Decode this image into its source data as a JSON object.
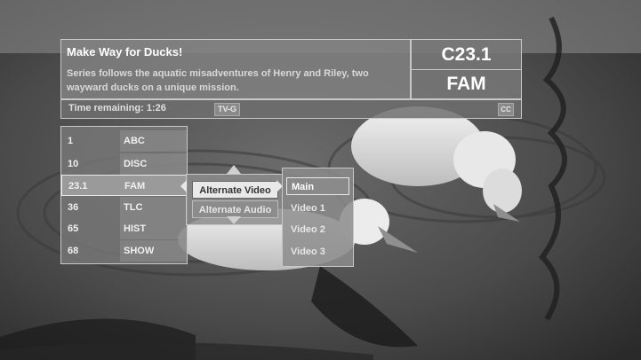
{
  "program": {
    "title": "Make Way for Ducks!",
    "description": "Series follows the aquatic misadventures of Henry and Riley, two wayward ducks on a unique mission.",
    "time_remaining": "Time remaining: 1:26",
    "rating": "TV-G",
    "cc": "CC"
  },
  "current_channel": {
    "number": "C23.1",
    "callsign": "FAM"
  },
  "channel_list": [
    {
      "number": "1",
      "callsign": "ABC",
      "selected": false
    },
    {
      "number": "10",
      "callsign": "DISC",
      "selected": false
    },
    {
      "number": "23.1",
      "callsign": "FAM",
      "selected": true
    },
    {
      "number": "36",
      "callsign": "TLC",
      "selected": false
    },
    {
      "number": "65",
      "callsign": "HIST",
      "selected": false
    },
    {
      "number": "68",
      "callsign": "SHOW",
      "selected": false
    }
  ],
  "options": {
    "alternate_video": "Alternate Video",
    "alternate_audio": "Alternate Audio"
  },
  "video_tracks": [
    "Main",
    "Video 1",
    "Video 2",
    "Video 3"
  ],
  "selected_video_track": "Main"
}
